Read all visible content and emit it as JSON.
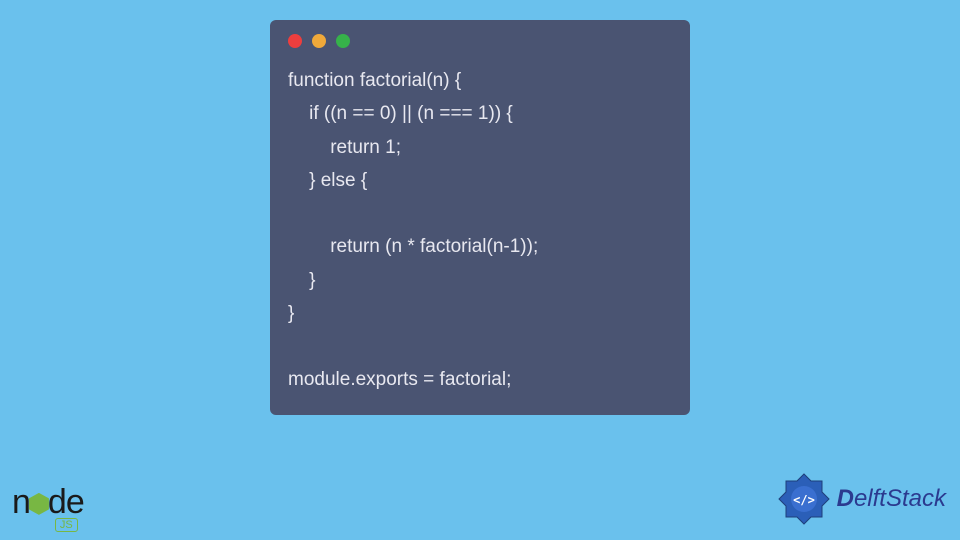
{
  "code": {
    "lines": [
      "function factorial(n) {",
      "    if ((n == 0) || (n === 1)) {",
      "        return 1;",
      "    } else {",
      "",
      "        return (n * factorial(n-1));",
      "    }",
      "}",
      "",
      "module.exports = factorial;"
    ]
  },
  "window": {
    "dot_colors": {
      "red": "#ed3e3e",
      "yellow": "#f0a93a",
      "green": "#36b24a"
    }
  },
  "logos": {
    "nodejs": {
      "text_left": "n",
      "text_right": "de",
      "sub": "JS",
      "accent": "#78b743"
    },
    "delftstack": {
      "brand_d": "D",
      "brand_rest": "elftStack",
      "glyph": "</>",
      "color": "#2b3a8f"
    }
  }
}
